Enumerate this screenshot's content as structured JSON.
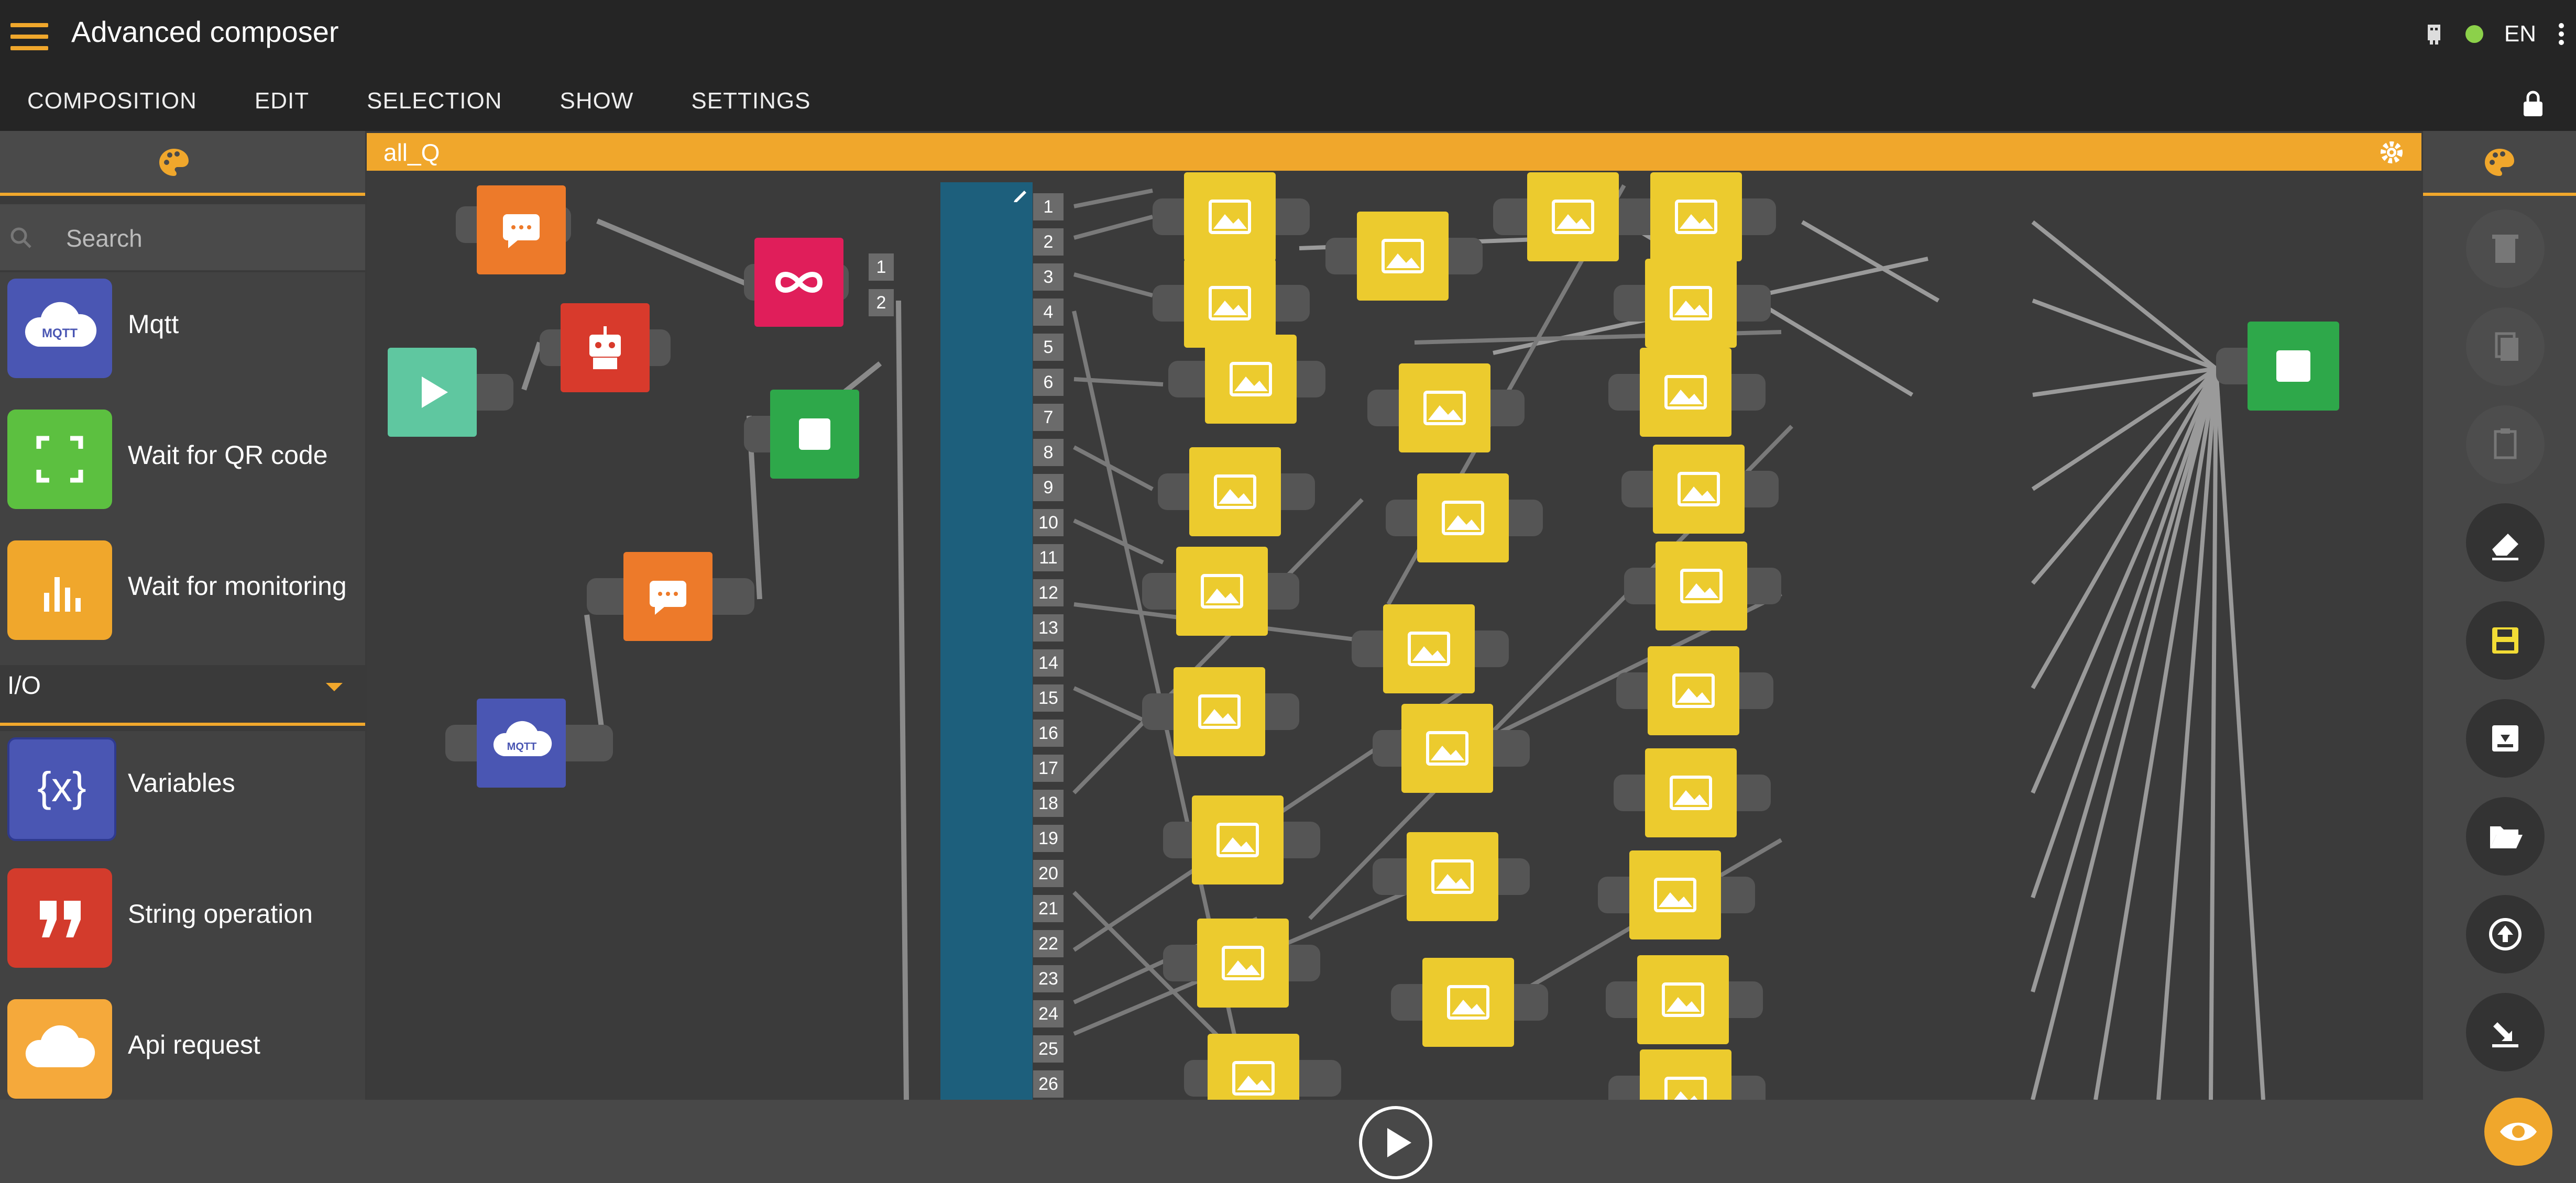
{
  "app": {
    "title": "Advanced composer",
    "language": "EN",
    "accent": "#f0a72c"
  },
  "menu": [
    "COMPOSITION",
    "EDIT",
    "SELECTION",
    "SHOW",
    "SETTINGS"
  ],
  "left_panel": {
    "search_placeholder": "Search",
    "items_top": [
      {
        "label": "Mqtt",
        "icon": "mqtt-cloud-icon",
        "color": "#4a56b3"
      },
      {
        "label": "Wait for QR code",
        "icon": "qr-scan-icon",
        "color": "#5cc040"
      },
      {
        "label": "Wait for monitoring",
        "icon": "bar-chart-icon",
        "color": "#f0a72c"
      }
    ],
    "category": "I/O",
    "items_bottom": [
      {
        "label": "Variables",
        "icon": "variables-icon",
        "color": "#4a56b3"
      },
      {
        "label": "String operation",
        "icon": "quote-icon",
        "color": "#d33b2c"
      },
      {
        "label": "Api request",
        "icon": "cloud-icon",
        "color": "#f5a93b"
      }
    ]
  },
  "canvas": {
    "tab_name": "all_Q",
    "split_outputs": [
      "1",
      "2"
    ],
    "switch_outputs": [
      "1",
      "2",
      "3",
      "4",
      "5",
      "6",
      "7",
      "8",
      "9",
      "10",
      "11",
      "12",
      "13",
      "14",
      "15",
      "16",
      "17",
      "18",
      "19",
      "20",
      "21",
      "22",
      "23",
      "24",
      "25",
      "26"
    ]
  }
}
